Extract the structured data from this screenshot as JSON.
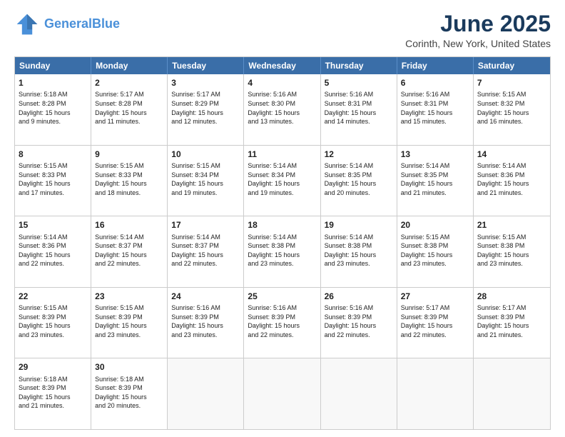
{
  "logo": {
    "line1": "General",
    "line2": "Blue"
  },
  "title": "June 2025",
  "subtitle": "Corinth, New York, United States",
  "headers": [
    "Sunday",
    "Monday",
    "Tuesday",
    "Wednesday",
    "Thursday",
    "Friday",
    "Saturday"
  ],
  "rows": [
    [
      {
        "day": "1",
        "lines": [
          "Sunrise: 5:18 AM",
          "Sunset: 8:28 PM",
          "Daylight: 15 hours",
          "and 9 minutes."
        ]
      },
      {
        "day": "2",
        "lines": [
          "Sunrise: 5:17 AM",
          "Sunset: 8:28 PM",
          "Daylight: 15 hours",
          "and 11 minutes."
        ]
      },
      {
        "day": "3",
        "lines": [
          "Sunrise: 5:17 AM",
          "Sunset: 8:29 PM",
          "Daylight: 15 hours",
          "and 12 minutes."
        ]
      },
      {
        "day": "4",
        "lines": [
          "Sunrise: 5:16 AM",
          "Sunset: 8:30 PM",
          "Daylight: 15 hours",
          "and 13 minutes."
        ]
      },
      {
        "day": "5",
        "lines": [
          "Sunrise: 5:16 AM",
          "Sunset: 8:31 PM",
          "Daylight: 15 hours",
          "and 14 minutes."
        ]
      },
      {
        "day": "6",
        "lines": [
          "Sunrise: 5:16 AM",
          "Sunset: 8:31 PM",
          "Daylight: 15 hours",
          "and 15 minutes."
        ]
      },
      {
        "day": "7",
        "lines": [
          "Sunrise: 5:15 AM",
          "Sunset: 8:32 PM",
          "Daylight: 15 hours",
          "and 16 minutes."
        ]
      }
    ],
    [
      {
        "day": "8",
        "lines": [
          "Sunrise: 5:15 AM",
          "Sunset: 8:33 PM",
          "Daylight: 15 hours",
          "and 17 minutes."
        ]
      },
      {
        "day": "9",
        "lines": [
          "Sunrise: 5:15 AM",
          "Sunset: 8:33 PM",
          "Daylight: 15 hours",
          "and 18 minutes."
        ]
      },
      {
        "day": "10",
        "lines": [
          "Sunrise: 5:15 AM",
          "Sunset: 8:34 PM",
          "Daylight: 15 hours",
          "and 19 minutes."
        ]
      },
      {
        "day": "11",
        "lines": [
          "Sunrise: 5:14 AM",
          "Sunset: 8:34 PM",
          "Daylight: 15 hours",
          "and 19 minutes."
        ]
      },
      {
        "day": "12",
        "lines": [
          "Sunrise: 5:14 AM",
          "Sunset: 8:35 PM",
          "Daylight: 15 hours",
          "and 20 minutes."
        ]
      },
      {
        "day": "13",
        "lines": [
          "Sunrise: 5:14 AM",
          "Sunset: 8:35 PM",
          "Daylight: 15 hours",
          "and 21 minutes."
        ]
      },
      {
        "day": "14",
        "lines": [
          "Sunrise: 5:14 AM",
          "Sunset: 8:36 PM",
          "Daylight: 15 hours",
          "and 21 minutes."
        ]
      }
    ],
    [
      {
        "day": "15",
        "lines": [
          "Sunrise: 5:14 AM",
          "Sunset: 8:36 PM",
          "Daylight: 15 hours",
          "and 22 minutes."
        ]
      },
      {
        "day": "16",
        "lines": [
          "Sunrise: 5:14 AM",
          "Sunset: 8:37 PM",
          "Daylight: 15 hours",
          "and 22 minutes."
        ]
      },
      {
        "day": "17",
        "lines": [
          "Sunrise: 5:14 AM",
          "Sunset: 8:37 PM",
          "Daylight: 15 hours",
          "and 22 minutes."
        ]
      },
      {
        "day": "18",
        "lines": [
          "Sunrise: 5:14 AM",
          "Sunset: 8:38 PM",
          "Daylight: 15 hours",
          "and 23 minutes."
        ]
      },
      {
        "day": "19",
        "lines": [
          "Sunrise: 5:14 AM",
          "Sunset: 8:38 PM",
          "Daylight: 15 hours",
          "and 23 minutes."
        ]
      },
      {
        "day": "20",
        "lines": [
          "Sunrise: 5:15 AM",
          "Sunset: 8:38 PM",
          "Daylight: 15 hours",
          "and 23 minutes."
        ]
      },
      {
        "day": "21",
        "lines": [
          "Sunrise: 5:15 AM",
          "Sunset: 8:38 PM",
          "Daylight: 15 hours",
          "and 23 minutes."
        ]
      }
    ],
    [
      {
        "day": "22",
        "lines": [
          "Sunrise: 5:15 AM",
          "Sunset: 8:39 PM",
          "Daylight: 15 hours",
          "and 23 minutes."
        ]
      },
      {
        "day": "23",
        "lines": [
          "Sunrise: 5:15 AM",
          "Sunset: 8:39 PM",
          "Daylight: 15 hours",
          "and 23 minutes."
        ]
      },
      {
        "day": "24",
        "lines": [
          "Sunrise: 5:16 AM",
          "Sunset: 8:39 PM",
          "Daylight: 15 hours",
          "and 23 minutes."
        ]
      },
      {
        "day": "25",
        "lines": [
          "Sunrise: 5:16 AM",
          "Sunset: 8:39 PM",
          "Daylight: 15 hours",
          "and 22 minutes."
        ]
      },
      {
        "day": "26",
        "lines": [
          "Sunrise: 5:16 AM",
          "Sunset: 8:39 PM",
          "Daylight: 15 hours",
          "and 22 minutes."
        ]
      },
      {
        "day": "27",
        "lines": [
          "Sunrise: 5:17 AM",
          "Sunset: 8:39 PM",
          "Daylight: 15 hours",
          "and 22 minutes."
        ]
      },
      {
        "day": "28",
        "lines": [
          "Sunrise: 5:17 AM",
          "Sunset: 8:39 PM",
          "Daylight: 15 hours",
          "and 21 minutes."
        ]
      }
    ],
    [
      {
        "day": "29",
        "lines": [
          "Sunrise: 5:18 AM",
          "Sunset: 8:39 PM",
          "Daylight: 15 hours",
          "and 21 minutes."
        ]
      },
      {
        "day": "30",
        "lines": [
          "Sunrise: 5:18 AM",
          "Sunset: 8:39 PM",
          "Daylight: 15 hours",
          "and 20 minutes."
        ]
      },
      {
        "day": "",
        "lines": []
      },
      {
        "day": "",
        "lines": []
      },
      {
        "day": "",
        "lines": []
      },
      {
        "day": "",
        "lines": []
      },
      {
        "day": "",
        "lines": []
      }
    ]
  ]
}
